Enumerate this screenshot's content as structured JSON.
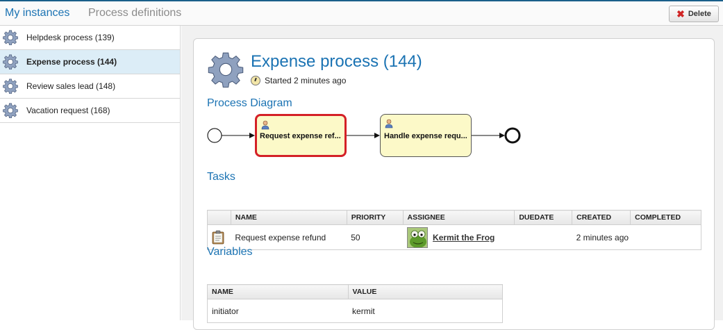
{
  "topbar": {
    "tab_active": "My instances",
    "tab_inactive": "Process definitions",
    "delete_label": "Delete",
    "delete_icon": "red-x-icon"
  },
  "sidebar": {
    "items": [
      {
        "label": "Helpdesk process (139)",
        "icon": "gear-icon"
      },
      {
        "label": "Expense process (144)",
        "icon": "gear-icon",
        "selected": true
      },
      {
        "label": "Review sales lead (148)",
        "icon": "gear-icon"
      },
      {
        "label": "Vacation request (168)",
        "icon": "gear-icon"
      }
    ]
  },
  "detail": {
    "title": "Expense process (144)",
    "started": "Started 2 minutes ago",
    "diagram_title": "Process Diagram",
    "diagram": {
      "tasks": [
        {
          "label": "Request expense ref...",
          "active": true
        },
        {
          "label": "Handle expense requ...",
          "active": false
        }
      ]
    },
    "tasks_title": "Tasks",
    "tasks_columns": [
      "NAME",
      "PRIORITY",
      "ASSIGNEE",
      "DUEDATE",
      "CREATED",
      "COMPLETED"
    ],
    "tasks_rows": [
      {
        "name": "Request expense refund",
        "priority": "50",
        "assignee": "Kermit the Frog",
        "duedate": "",
        "created": "2 minutes ago",
        "completed": ""
      }
    ],
    "variables_title": "Variables",
    "variables_columns": [
      "NAME",
      "VALUE"
    ],
    "variables_rows": [
      {
        "name": "initiator",
        "value": "kermit"
      }
    ]
  },
  "colors": {
    "accent": "#1b73b3",
    "selected_bg": "#dcedf7",
    "active_task_border": "#d42027",
    "task_fill": "#fcf9c8"
  }
}
